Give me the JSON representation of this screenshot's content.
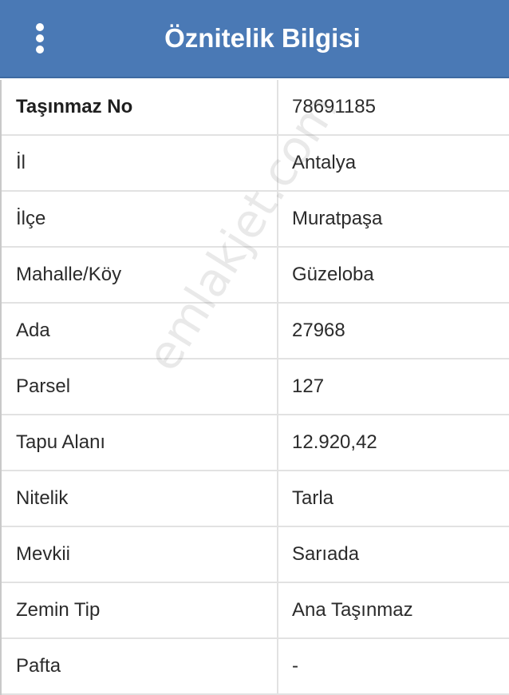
{
  "header": {
    "title": "Öznitelik Bilgisi",
    "menu_icon": "more-vert-icon"
  },
  "attributes": [
    {
      "label": "Taşınmaz No",
      "value": "78691185"
    },
    {
      "label": "İl",
      "value": "Antalya"
    },
    {
      "label": "İlçe",
      "value": "Muratpaşa"
    },
    {
      "label": "Mahalle/Köy",
      "value": "Güzeloba"
    },
    {
      "label": "Ada",
      "value": "27968"
    },
    {
      "label": "Parsel",
      "value": "127"
    },
    {
      "label": "Tapu Alanı",
      "value": "12.920,42"
    },
    {
      "label": "Nitelik",
      "value": "Tarla"
    },
    {
      "label": "Mevkii",
      "value": "Sarıada"
    },
    {
      "label": "Zemin Tip",
      "value": "Ana Taşınmaz"
    },
    {
      "label": "Pafta",
      "value": "-"
    }
  ],
  "watermark": "emlakjet.com",
  "colors": {
    "header_bg": "#4a79b5",
    "header_text": "#ffffff",
    "row_border": "#e2e2e2",
    "text": "#2b2b2b"
  }
}
